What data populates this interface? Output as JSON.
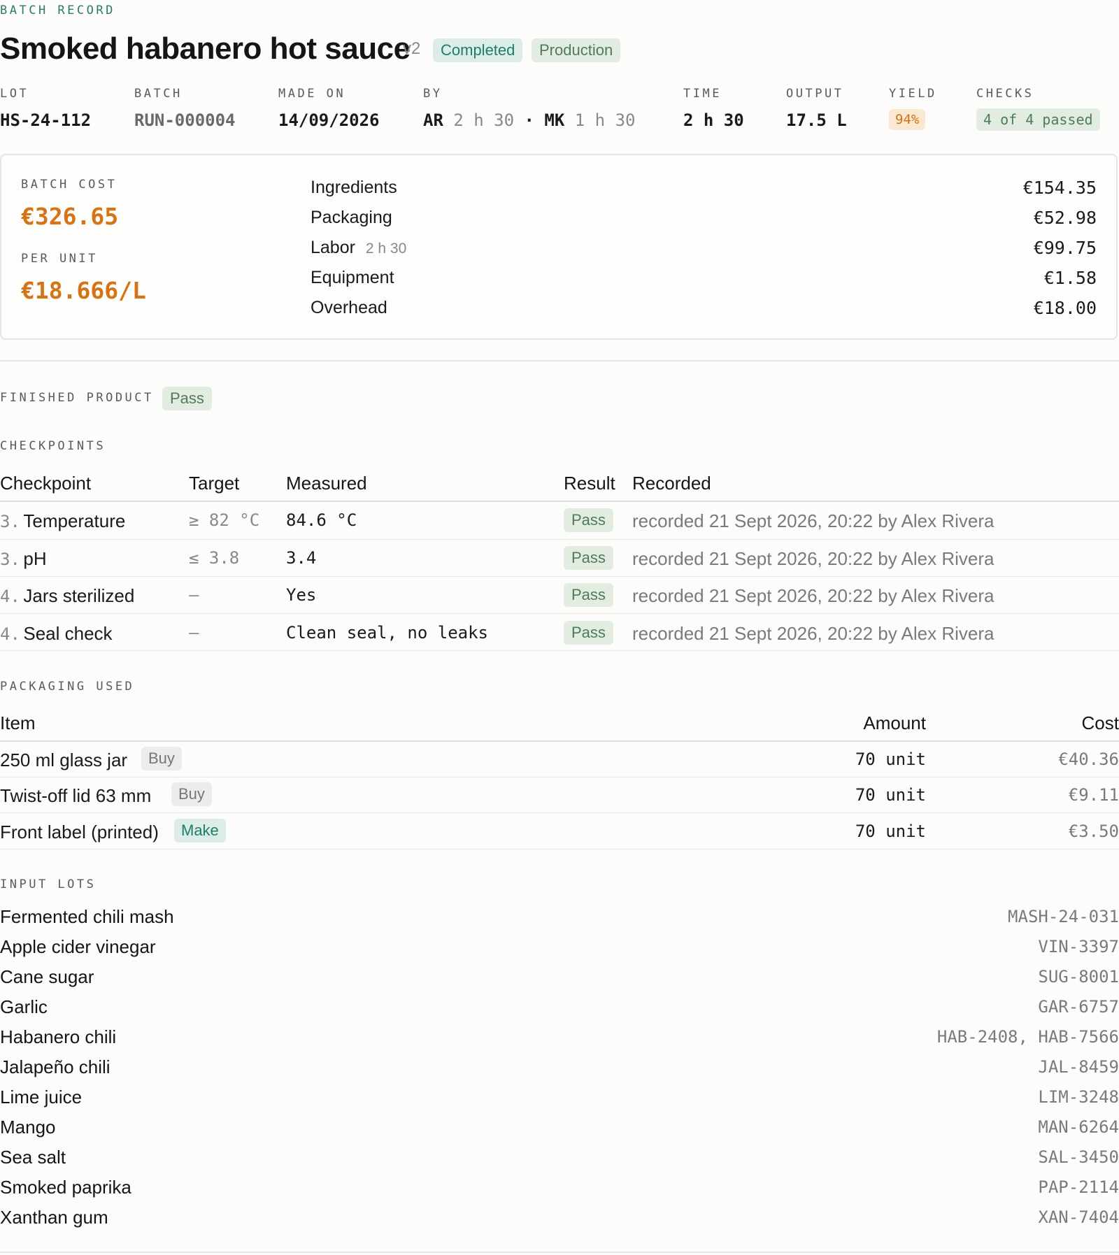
{
  "header": {
    "eyebrow": "BATCH RECORD",
    "title": "Smoked habanero hot sauce",
    "version": "v2",
    "status_badge": "Completed",
    "mode_badge": "Production"
  },
  "meta": {
    "lot": {
      "label": "LOT",
      "value": "HS-24-112"
    },
    "batch": {
      "label": "BATCH",
      "value": "RUN-000004"
    },
    "made_on": {
      "label": "MADE ON",
      "value": "14/09/2026"
    },
    "by": {
      "label": "BY",
      "person1": "AR",
      "time1": "2 h 30",
      "sep": "·",
      "person2": "MK",
      "time2": "1 h 30"
    },
    "time": {
      "label": "TIME",
      "value": "2 h 30"
    },
    "output": {
      "label": "OUTPUT",
      "value": "17.5 L"
    },
    "yield": {
      "label": "YIELD",
      "value": "94%"
    },
    "checks": {
      "label": "CHECKS",
      "value": "4 of 4 passed"
    }
  },
  "cost": {
    "batch_cost_label": "BATCH COST",
    "batch_cost_value": "€326.65",
    "per_unit_label": "PER UNIT",
    "per_unit_value": "€18.666/L",
    "breakdown": [
      {
        "label": "Ingredients",
        "sub": "",
        "value": "€154.35"
      },
      {
        "label": "Packaging",
        "sub": "",
        "value": "€52.98"
      },
      {
        "label": "Labor",
        "sub": "2 h 30",
        "value": "€99.75"
      },
      {
        "label": "Equipment",
        "sub": "",
        "value": "€1.58"
      },
      {
        "label": "Overhead",
        "sub": "",
        "value": "€18.00"
      }
    ]
  },
  "finished_product": {
    "label": "FINISHED PRODUCT",
    "result": "Pass"
  },
  "checkpoints": {
    "label": "CHECKPOINTS",
    "columns": [
      "Checkpoint",
      "Target",
      "Measured",
      "Result",
      "Recorded"
    ],
    "rows": [
      {
        "num": "3.",
        "name": "Temperature",
        "target": "≥ 82 °C",
        "measured": "84.6 °C",
        "result": "Pass",
        "recorded": "recorded 21 Sept 2026, 20:22 by Alex Rivera"
      },
      {
        "num": "3.",
        "name": "pH",
        "target": "≤ 3.8",
        "measured": "3.4",
        "result": "Pass",
        "recorded": "recorded 21 Sept 2026, 20:22 by Alex Rivera"
      },
      {
        "num": "4.",
        "name": "Jars sterilized",
        "target": "–",
        "measured": "Yes",
        "result": "Pass",
        "recorded": "recorded 21 Sept 2026, 20:22 by Alex Rivera"
      },
      {
        "num": "4.",
        "name": "Seal check",
        "target": "–",
        "measured": "Clean seal, no leaks",
        "result": "Pass",
        "recorded": "recorded 21 Sept 2026, 20:22 by Alex Rivera"
      }
    ]
  },
  "packaging": {
    "label": "PACKAGING USED",
    "columns": [
      "Item",
      "Amount",
      "Cost"
    ],
    "rows": [
      {
        "item": "250 ml glass jar",
        "tag": "Buy",
        "amount": "70 unit",
        "cost": "€40.36"
      },
      {
        "item": "Twist-off lid 63 mm",
        "tag": "Buy",
        "amount": "70 unit",
        "cost": "€9.11"
      },
      {
        "item": "Front label (printed)",
        "tag": "Make",
        "amount": "70 unit",
        "cost": "€3.50"
      }
    ]
  },
  "input_lots": {
    "label": "INPUT LOTS",
    "rows": [
      {
        "name": "Fermented chili mash",
        "lots": "MASH-24-031"
      },
      {
        "name": "Apple cider vinegar",
        "lots": "VIN-3397"
      },
      {
        "name": "Cane sugar",
        "lots": "SUG-8001"
      },
      {
        "name": "Garlic",
        "lots": "GAR-6757"
      },
      {
        "name": "Habanero chili",
        "lots": "HAB-2408, HAB-7566"
      },
      {
        "name": "Jalapeño chili",
        "lots": "JAL-8459"
      },
      {
        "name": "Lime juice",
        "lots": "LIM-3248"
      },
      {
        "name": "Mango",
        "lots": "MAN-6264"
      },
      {
        "name": "Sea salt",
        "lots": "SAL-3450"
      },
      {
        "name": "Smoked paprika",
        "lots": "PAP-2114"
      },
      {
        "name": "Xanthan gum",
        "lots": "XAN-7404"
      }
    ]
  }
}
